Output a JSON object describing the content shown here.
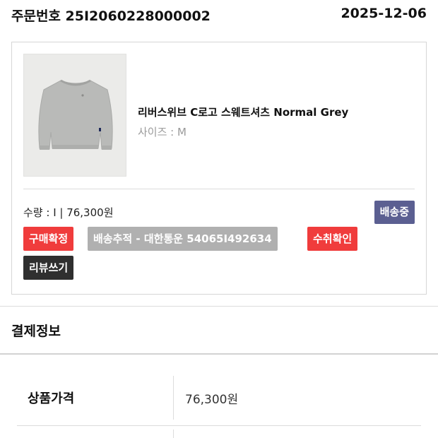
{
  "order": {
    "label": "주문번호 25I2060228000002",
    "date": "2025-12-06"
  },
  "product": {
    "name": "리버스위브 C로고 스웨트셔츠 Normal Grey",
    "option": "사이즈 : M",
    "qty_price": "수량 : I | 76,300원",
    "status": "배송중",
    "image_icon": "grey-sweatshirt-image"
  },
  "actions": {
    "confirm": "구매확정",
    "track": "배송추적 - 대한통운 54065I492634",
    "receive": "수취확인",
    "review": "리뷰쓰기"
  },
  "payment": {
    "title": "결제정보",
    "rows": [
      {
        "label": "상품가격",
        "value": "76,300원"
      }
    ]
  },
  "colors": {
    "red": "#f03c3c",
    "grey": "#b0b0b0",
    "dark": "#2f2f2f",
    "status": "#5b5f91"
  }
}
